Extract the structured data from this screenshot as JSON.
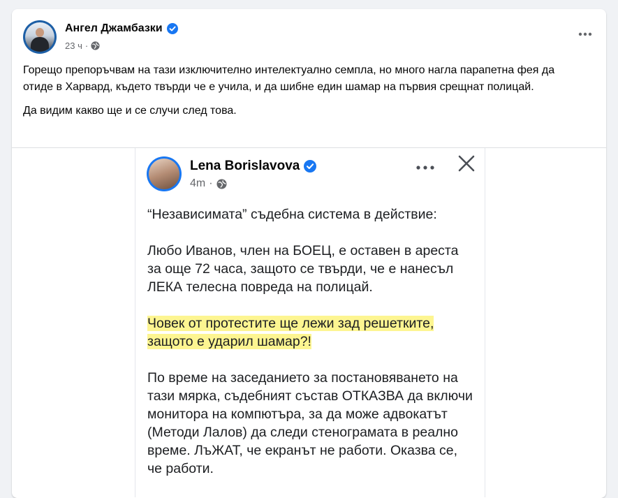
{
  "post": {
    "author": {
      "name": "Ангел Джамбазки",
      "verified": true
    },
    "meta": {
      "time": "23 ч",
      "audience_icon": "globe-icon"
    },
    "more_icon": "more-horizontal-icon",
    "text_paragraphs": [
      "Горещо препоръчвам на тази изключително интелектуално семпла, но много нагла парапетна фея да отиде в Харвард, където твърди че е учила, и да шибне един шамар на първия срещнат полицай.",
      "Да видим какво ще и се случи след това."
    ]
  },
  "embedded_screenshot": {
    "author": {
      "name": "Lena Borislavova",
      "verified": true
    },
    "meta": {
      "time": "4m",
      "audience_icon": "globe-icon"
    },
    "icons": [
      "more-horizontal-icon",
      "close-icon"
    ],
    "paragraph_1": "“Независимата” съдебна система в действие:",
    "paragraph_2": "Любо Иванов, член на БОЕЦ, е оставен в ареста за още 72 часа, защото се твърди, че е нанесъл ЛЕКА телесна повреда на полицай.",
    "highlight_line_1": "Човек от протестите ще лежи зад решетките,",
    "highlight_line_2": "защото е ударил шамар?!",
    "paragraph_4": "По време на заседанието за постановяването на тази мярка, съдебният състав ОТКАЗВА да включи монитора на компютъра, за да може адвокатът (Методи Лалов) да следи стенограмата в реално време. ЛъЖАТ, че екранът не работи. Оказва се, че работи.",
    "highlight_color": "#fdf591"
  },
  "colors": {
    "page_bg": "#f0f2f5",
    "verified_blue": "#1877f2",
    "secondary_text": "#65676b"
  }
}
